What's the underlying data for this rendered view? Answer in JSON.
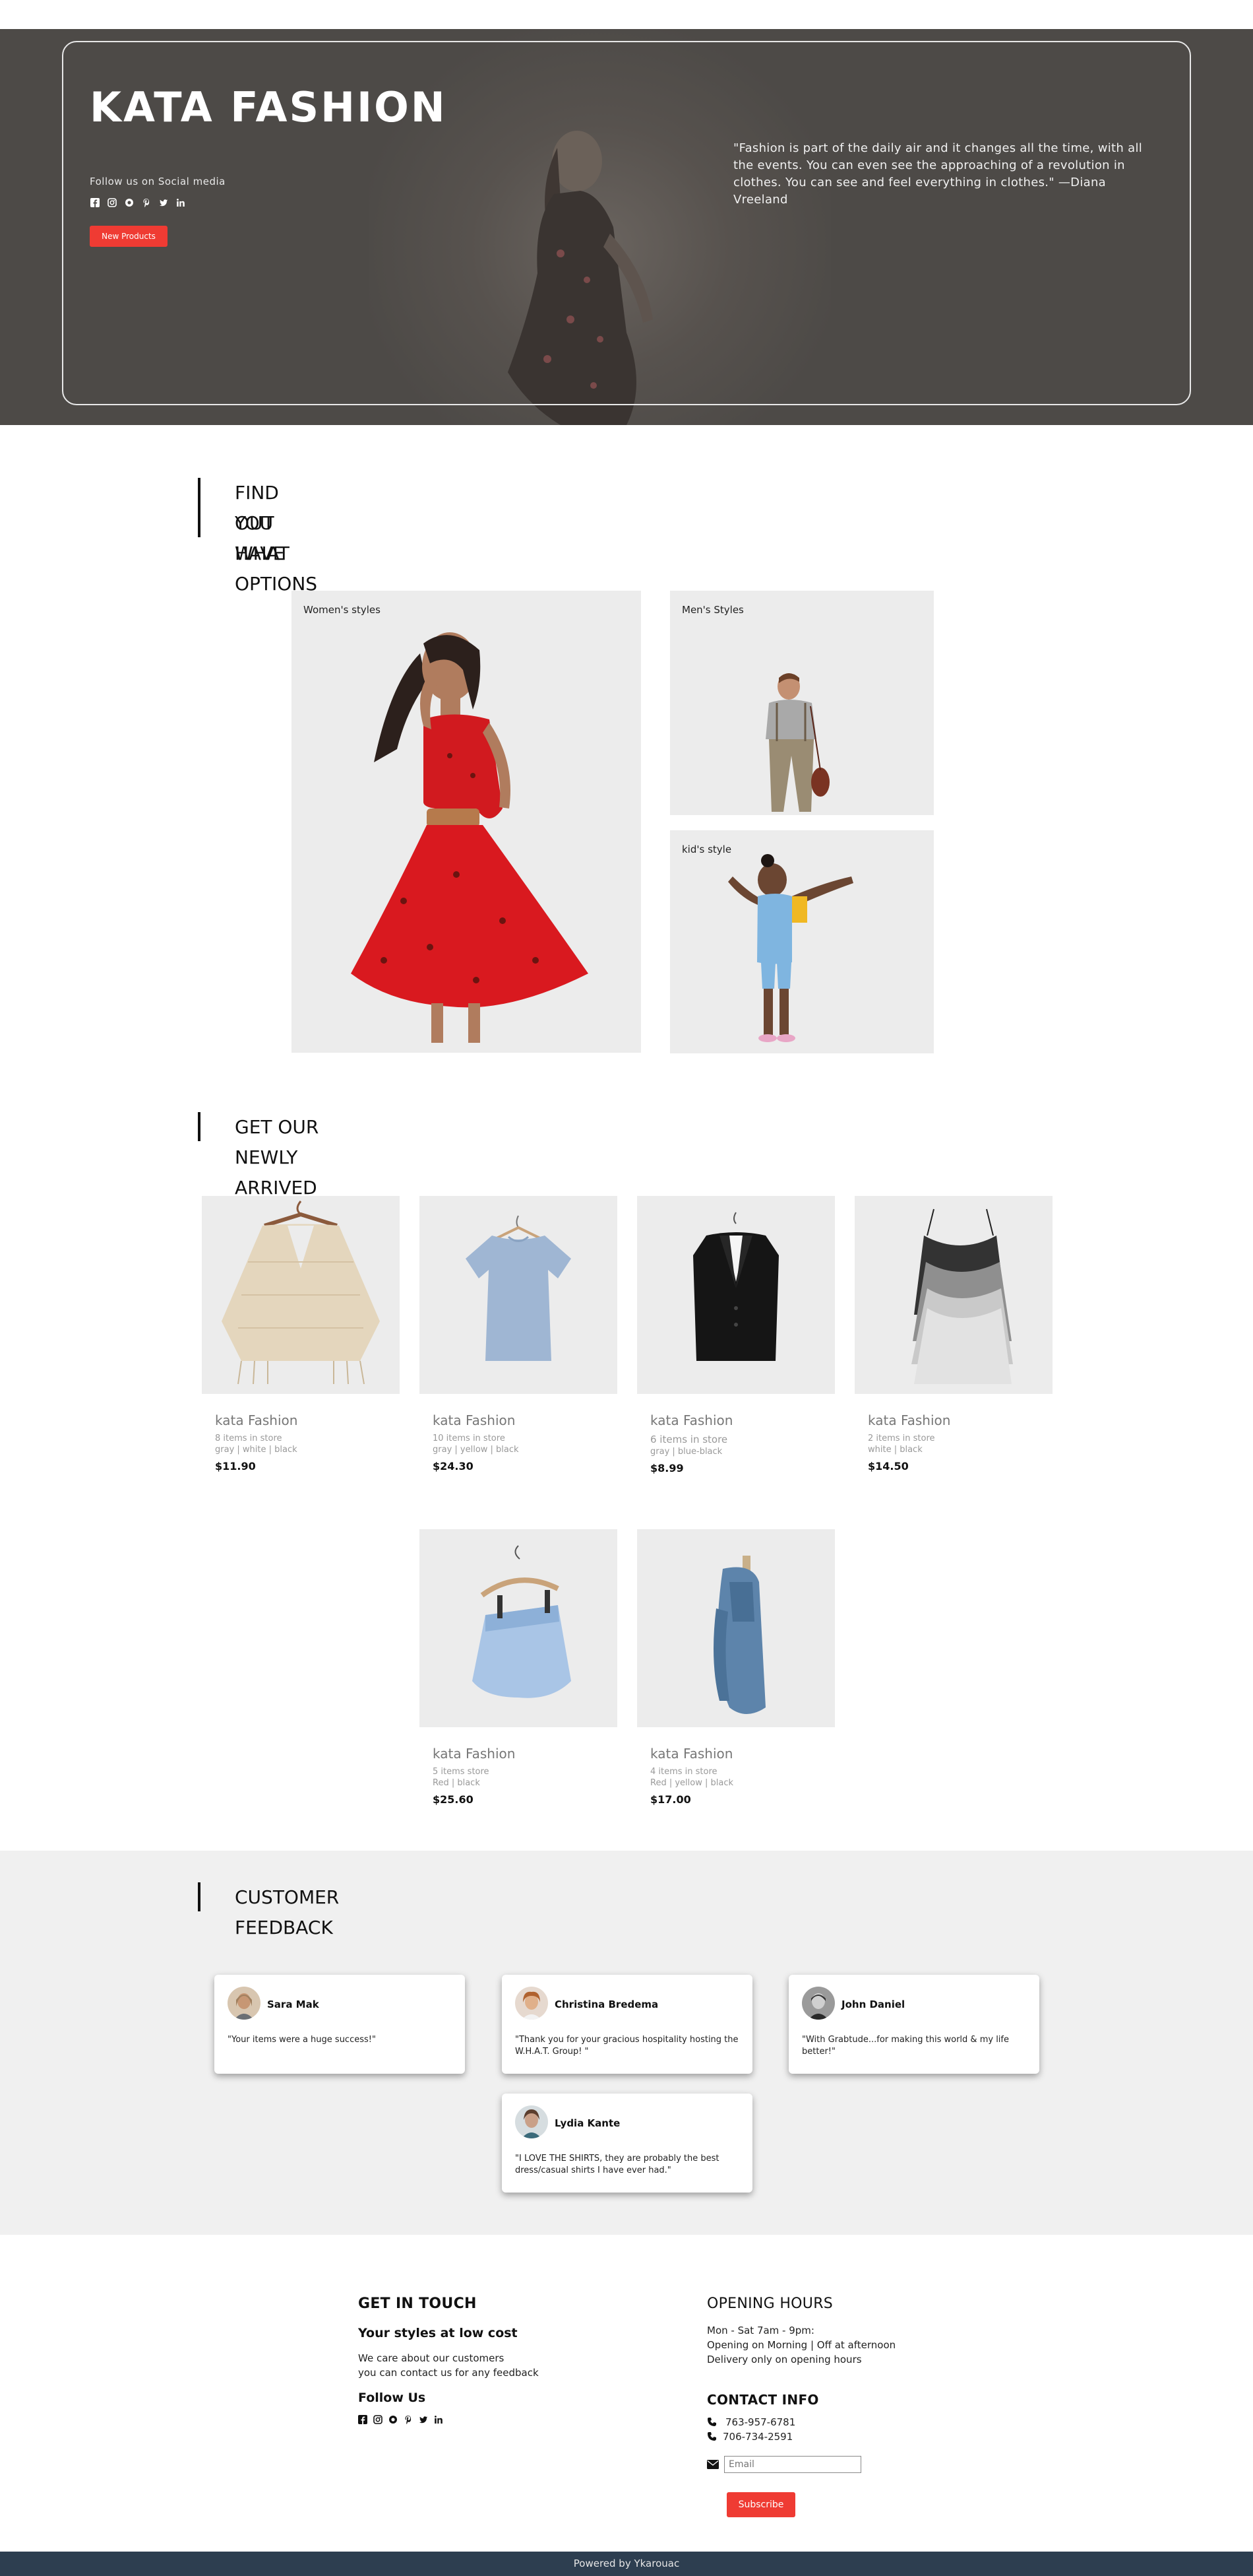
{
  "hero": {
    "title": "KATA FASHION",
    "follow_text": "Follow us on Social media",
    "social_icons": [
      "facebook-icon",
      "instagram-icon",
      "opencollective-icon",
      "pinterest-icon",
      "twitter-icon",
      "linkedin-icon"
    ],
    "button_label": "New Products",
    "quote": "\"Fashion is part of the daily air and it changes all the time, with all the events. You can even see the approaching of a revolution in clothes. You can see and feel everything in clothes.\" —Diana Vreeland"
  },
  "options": {
    "heading_line1": "FIND OUT WHAT OPTIONS",
    "heading_line2": "YOU HAVE",
    "women": "Women's styles",
    "men": "Men's Styles",
    "kids": "kid's style"
  },
  "products": {
    "heading": "GET OUR NEWLY ARRIVED PRODUCTS",
    "items": [
      {
        "name": "kata Fashion",
        "stock": "8 items in store",
        "colors": "gray | white | black",
        "price": "$11.90"
      },
      {
        "name": "kata Fashion",
        "stock": "10 items in store",
        "colors": "gray | yellow | black",
        "price": "$24.30"
      },
      {
        "name": "kata Fashion",
        "stock": "6 items in store",
        "colors": "gray | blue-black",
        "price": "$8.99"
      },
      {
        "name": "kata Fashion",
        "stock": "2 items in store",
        "colors": "white | black",
        "price": "$14.50"
      },
      {
        "name": "kata Fashion",
        "stock": "5 items store",
        "colors": "Red | black",
        "price": "$25.60"
      },
      {
        "name": "kata Fashion",
        "stock": "4 items in store",
        "colors": "Red | yellow | black",
        "price": "$17.00"
      }
    ]
  },
  "feedback": {
    "heading": "CUSTOMER FEEDBACK",
    "cards": [
      {
        "name": "Sara Mak",
        "text": "\"Your items were a huge success!\""
      },
      {
        "name": "Christina Bredema",
        "text": "\"Thank you for your gracious hospitality hosting the W.H.A.T. Group! \""
      },
      {
        "name": "John Daniel",
        "text": "\"With Grabtude...for making this world & my life better!\""
      },
      {
        "name": "Lydia Kante",
        "text": "\"I LOVE THE SHIRTS, they are probably the best dress/casual shirts I have ever had.\""
      }
    ]
  },
  "footer": {
    "get_in_touch": "GET IN TOUCH",
    "tagline": "Your styles at low cost",
    "about_line1": "We care about our customers",
    "about_line2": "you can contact us for any feedback",
    "follow_us": "Follow Us",
    "opening_hours": "OPENING HOURS",
    "hours_line1": "Mon - Sat 7am - 9pm:",
    "hours_line2": "Opening on Morning | Off at afternoon",
    "hours_line3": "Delivery only on opening hours",
    "contact_info": "CONTACT INFO",
    "phone1": "763-957-6781",
    "phone2": "706-734-2591",
    "email_placeholder": "Email",
    "subscribe_label": "Subscribe",
    "powered_by": "Powered by Ykarouac"
  },
  "colors": {
    "accent_red": "#ef3b33",
    "footer_bar": "#2d3e50",
    "hero_bg": "#4d4a47",
    "feedback_bg": "#f0f0f0"
  }
}
